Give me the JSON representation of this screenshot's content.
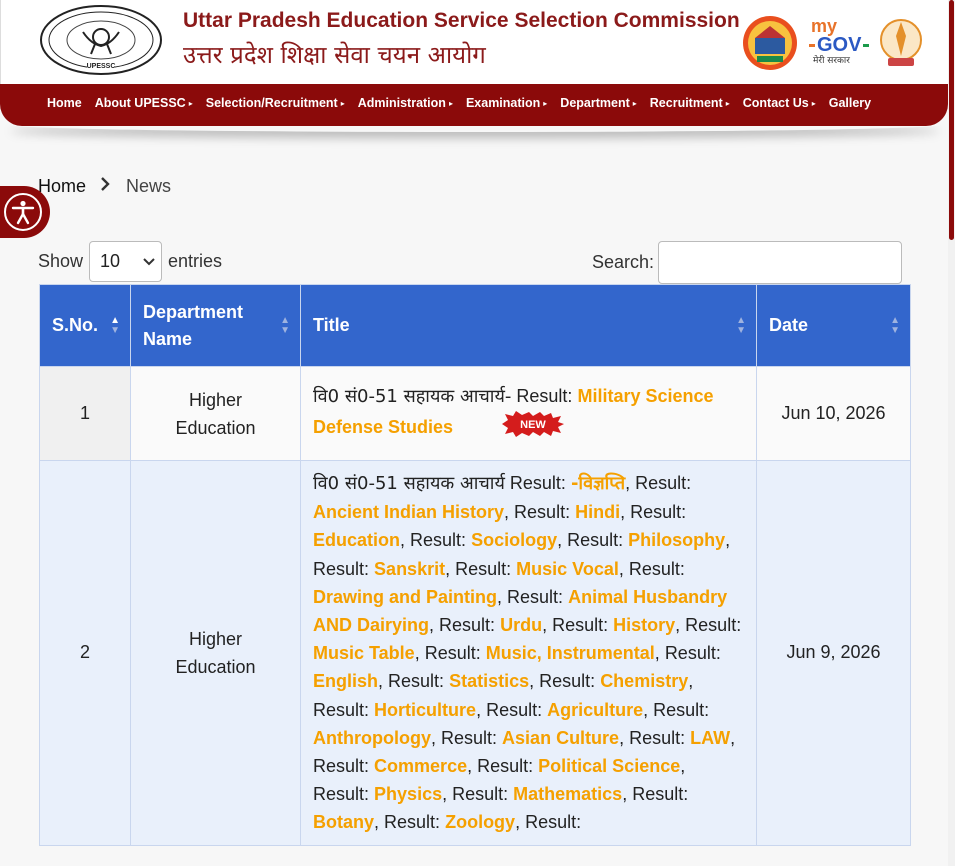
{
  "header": {
    "title_en": "Uttar Pradesh Education Service Selection Commission",
    "title_hi": "उत्तर प्रदेश शिक्षा सेवा चयन आयोग",
    "logo_text": "UPESSC",
    "mygov_my": "my",
    "mygov_gov": "GOV",
    "mygov_sub": "मेरी सरकार"
  },
  "nav": {
    "items": [
      {
        "label": "Home",
        "has_caret": false
      },
      {
        "label": "About UPESSC",
        "has_caret": true
      },
      {
        "label": "Selection/Recruitment",
        "has_caret": true
      },
      {
        "label": "Administration",
        "has_caret": true
      },
      {
        "label": "Examination",
        "has_caret": true
      },
      {
        "label": "Department",
        "has_caret": true
      },
      {
        "label": "Recruitment",
        "has_caret": true
      },
      {
        "label": "Contact Us",
        "has_caret": true
      },
      {
        "label": "Gallery",
        "has_caret": false
      }
    ]
  },
  "breadcrumb": {
    "home": "Home",
    "current": "News"
  },
  "controls": {
    "show_label": "Show",
    "entries_value": "10",
    "entries_label": "entries",
    "search_label": "Search:"
  },
  "table": {
    "headers": [
      "S.No.",
      "Department Name",
      "Title",
      "Date"
    ],
    "rows": [
      {
        "sno": "1",
        "dept": "Higher Education",
        "title_prefix": "वि0 सं0-51 सहायक आचार्य-",
        "date": "Jun 10, 2026",
        "badge": "NEW",
        "links": [
          "Military Science Defense Studies"
        ]
      },
      {
        "sno": "2",
        "dept": "Higher Education",
        "title_prefix": "वि0 सं0-51 सहायक आचार्य",
        "date": "Jun 9, 2026",
        "links": [
          "-विज्ञप्ति",
          "Ancient Indian History",
          "Hindi",
          "Education",
          "Sociology",
          "Philosophy",
          "Sanskrit",
          "Music Vocal",
          "Drawing and Painting",
          "Animal Husbandry AND Dairying",
          "Urdu",
          "History",
          "Music Table",
          "Music, Instrumental",
          "English",
          "Statistics",
          "Chemistry",
          "Horticulture",
          "Agriculture",
          "Anthropology",
          "Asian Culture",
          "LAW",
          "Commerce",
          "Political Science",
          "Physics",
          "Mathematics",
          "Botany",
          "Zoology"
        ]
      }
    ],
    "result_label": "Result:"
  },
  "colors": {
    "brand_maroon": "#8b0a0a",
    "table_header": "#3366cc",
    "link_orange": "#f5a000"
  }
}
